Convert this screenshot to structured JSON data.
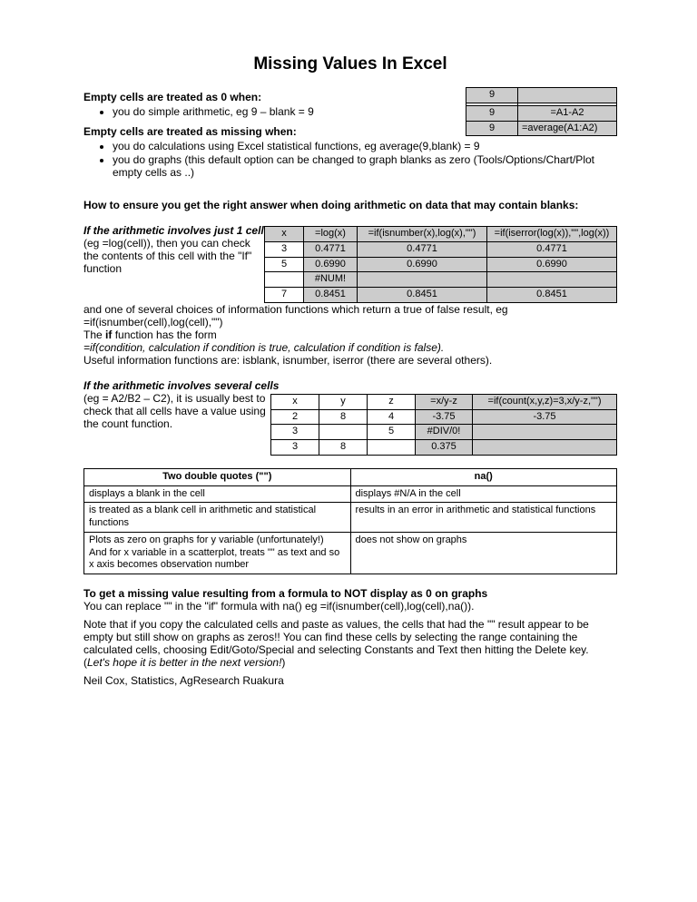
{
  "title": "Missing Values In Excel",
  "s1": {
    "h": "Empty cells are treated as 0 when:",
    "b1": "you do simple arithmetic, eg 9 – blank = 9"
  },
  "s2": {
    "h": "Empty cells are treated as missing when:",
    "b1": "you do calculations using Excel statistical functions, eg average(9,blank) = 9",
    "b2": "you do graphs (this default option can be changed to graph blanks as zero (Tools/Options/Chart/Plot empty cells as ..)"
  },
  "mt": {
    "a": "9",
    "b": "",
    "c": "9",
    "d": "=A1-A2",
    "e": "9",
    "f": "=average(A1:A2)"
  },
  "s3": {
    "h": "How to ensure you get the right answer when doing arithmetic on data that may contain blanks:"
  },
  "s4": {
    "h": "If the arithmetic involves just 1 cell",
    "t": " (eg =log(cell)), then you can check the contents of this cell with the \"If\" function"
  },
  "t2h": {
    "c1": "x",
    "c2": "=log(x)",
    "c3": "=if(isnumber(x),log(x),\"\")",
    "c4": "=if(iserror(log(x)),\"\",log(x))"
  },
  "t2r": [
    [
      "3",
      "0.4771",
      "0.4771",
      "0.4771"
    ],
    [
      "5",
      "0.6990",
      "0.6990",
      "0.6990"
    ],
    [
      "",
      "#NUM!",
      "",
      ""
    ],
    [
      "7",
      "0.8451",
      "0.8451",
      "0.8451"
    ]
  ],
  "s4b": {
    "l1": "and one of several choices of information functions which return a true of false result, eg =if(isnumber(cell),log(cell),\"\")",
    "l2a": "The ",
    "l2b": "if",
    "l2c": " function has the form",
    "l3": "=if(condition, calculation if condition is true, calculation if condition is false).",
    "l4": "Useful information functions are: isblank, isnumber, iserror (there are several others)."
  },
  "s5": {
    "h": "If the arithmetic involves several cells",
    "t": " (eg = A2/B2 – C2), it is usually best to check that all cells have a value using the count function."
  },
  "t3h": {
    "c1": "x",
    "c2": "y",
    "c3": "z",
    "c4": "=x/y-z",
    "c5": "=if(count(x,y,z)=3,x/y-z,\"\")"
  },
  "t3r": [
    [
      "2",
      "8",
      "4",
      "-3.75",
      "-3.75"
    ],
    [
      "3",
      "",
      "5",
      "#DIV/0!",
      ""
    ],
    [
      "3",
      "8",
      "",
      "0.375",
      ""
    ]
  ],
  "t4h": {
    "c1": "Two double quotes (\"\")",
    "c2": "na()"
  },
  "t4r": [
    [
      "displays a blank in the cell",
      "displays #N/A in the cell"
    ],
    [
      "is treated as a blank cell in arithmetic and statistical functions",
      "results in an error in arithmetic and statistical functions"
    ],
    [
      "Plots as zero on graphs for y variable (unfortunately!)\nAnd for x variable in a scatterplot, treats \"\" as text and so x axis becomes observation number",
      "does not show on graphs"
    ]
  ],
  "s6": {
    "h": "To get a missing value resulting from a formula to NOT display as 0 on graphs",
    "t": "You can replace \"\" in the \"if\" formula with na() eg =if(isnumber(cell),log(cell),na())."
  },
  "s7": {
    "t1": "Note that if you copy the calculated cells and paste as values, the cells that had the \"\" result appear to be empty but still show on graphs as zeros!! You can find these cells by selecting the range containing the calculated cells, choosing Edit/Goto/Special and selecting Constants and Text then hitting the Delete key. (",
    "t2": "Let's hope it is better in the next version!",
    "t3": ")"
  },
  "footer": "Neil Cox, Statistics, AgResearch Ruakura"
}
